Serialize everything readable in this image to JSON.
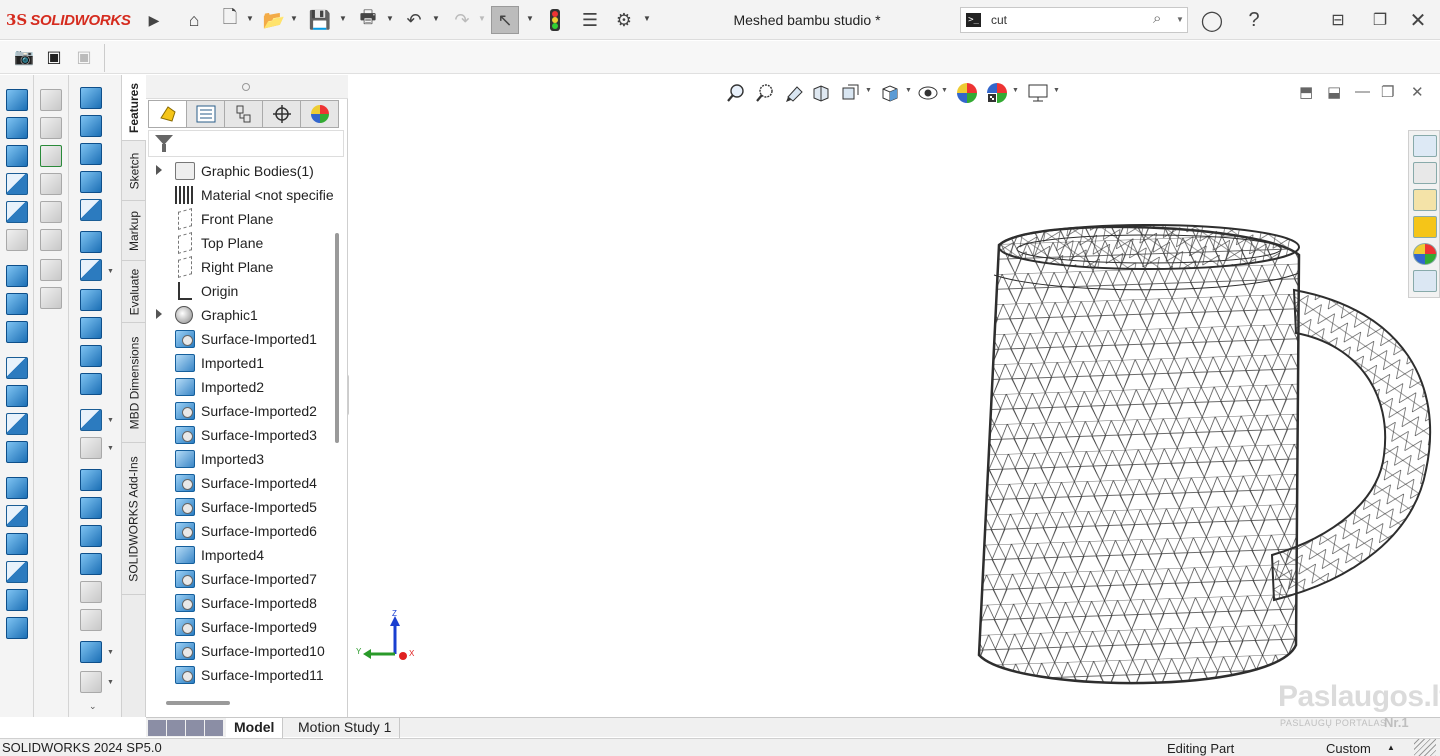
{
  "app": {
    "logo_mark": "3S",
    "logo_text": "SOLIDWORKS",
    "document_title": "Meshed bambu studio *"
  },
  "titlebar": {
    "icons": [
      "home-icon",
      "new-document-icon",
      "open-folder-icon",
      "save-icon",
      "print-icon",
      "undo-icon",
      "redo-icon",
      "select-arrow-icon",
      "rebuild-traffic-light-icon",
      "file-properties-icon",
      "options-gear-icon"
    ],
    "search": {
      "value": "cut",
      "placeholder": ""
    },
    "right_icons": [
      "account-icon",
      "help-icon",
      "minimize-icon",
      "restore-icon",
      "close-icon"
    ]
  },
  "vertical_tabs": [
    {
      "label": "Features",
      "active": true
    },
    {
      "label": "Sketch",
      "active": false
    },
    {
      "label": "Markup",
      "active": false
    },
    {
      "label": "Evaluate",
      "active": false
    },
    {
      "label": "MBD Dimensions",
      "active": false
    },
    {
      "label": "SOLIDWORKS Add-Ins",
      "active": false
    }
  ],
  "feature_manager": {
    "tabs": [
      "featuremanager-tree-icon",
      "property-manager-icon",
      "configuration-manager-icon",
      "dimxpert-icon",
      "display-manager-icon"
    ],
    "tree": [
      {
        "label": "Graphic Bodies(1)",
        "icon": "bodies",
        "expandable": true
      },
      {
        "label": "Material <not specifie",
        "icon": "material",
        "expandable": false
      },
      {
        "label": "Front Plane",
        "icon": "plane",
        "expandable": false
      },
      {
        "label": "Top Plane",
        "icon": "plane",
        "expandable": false
      },
      {
        "label": "Right Plane",
        "icon": "plane",
        "expandable": false
      },
      {
        "label": "Origin",
        "icon": "origin",
        "expandable": false
      },
      {
        "label": "Graphic1",
        "icon": "graphic",
        "expandable": true
      },
      {
        "label": "Surface-Imported1",
        "icon": "surface",
        "expandable": false
      },
      {
        "label": "Imported1",
        "icon": "imported",
        "expandable": false
      },
      {
        "label": "Imported2",
        "icon": "imported",
        "expandable": false
      },
      {
        "label": "Surface-Imported2",
        "icon": "surface",
        "expandable": false
      },
      {
        "label": "Surface-Imported3",
        "icon": "surface",
        "expandable": false
      },
      {
        "label": "Imported3",
        "icon": "imported",
        "expandable": false
      },
      {
        "label": "Surface-Imported4",
        "icon": "surface",
        "expandable": false
      },
      {
        "label": "Surface-Imported5",
        "icon": "surface",
        "expandable": false
      },
      {
        "label": "Surface-Imported6",
        "icon": "surface",
        "expandable": false
      },
      {
        "label": "Imported4",
        "icon": "imported",
        "expandable": false
      },
      {
        "label": "Surface-Imported7",
        "icon": "surface",
        "expandable": false
      },
      {
        "label": "Surface-Imported8",
        "icon": "surface",
        "expandable": false
      },
      {
        "label": "Surface-Imported9",
        "icon": "surface",
        "expandable": false
      },
      {
        "label": "Surface-Imported10",
        "icon": "surface",
        "expandable": false
      },
      {
        "label": "Surface-Imported11",
        "icon": "surface",
        "expandable": false
      }
    ]
  },
  "triad": {
    "x": "X",
    "y": "Y",
    "z": "Z"
  },
  "bottom_tabs": [
    {
      "label": "Model",
      "active": true
    },
    {
      "label": "Motion Study 1",
      "active": false
    }
  ],
  "status_bar": {
    "version": "SOLIDWORKS 2024 SP5.0",
    "mode": "Editing Part",
    "units": "Custom"
  },
  "watermark": {
    "main": "Paslaugos.lt",
    "sub": "PASLAUGŲ PORTALAS",
    "badge": "Nr.1"
  },
  "colors": {
    "brand_red": "#d52b1e",
    "feature_blue": "#2a7dc2",
    "mesh_line": "#3a3a3a"
  }
}
